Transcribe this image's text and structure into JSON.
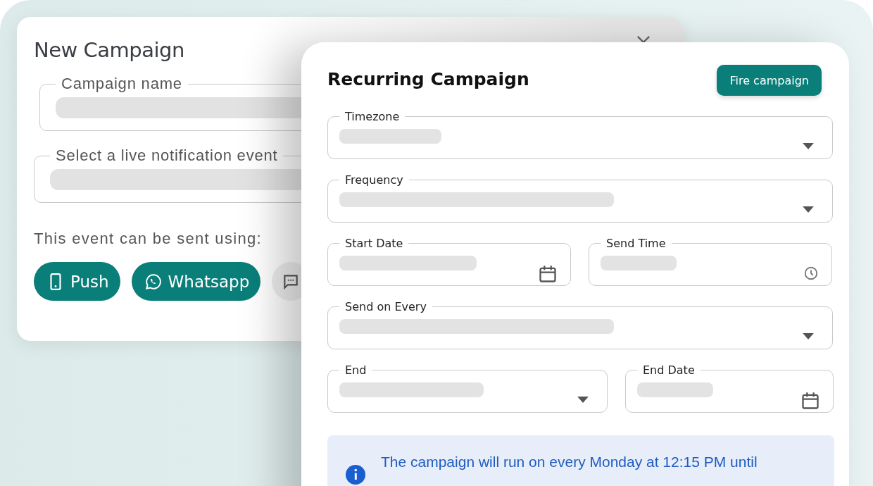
{
  "new_campaign": {
    "title": "New Campaign",
    "fields": [
      {
        "label": "Campaign name"
      },
      {
        "label": "Select a live notification event"
      }
    ],
    "channels_label": "This event can be sent using:",
    "channels": [
      {
        "label": "Push",
        "kind": "phone"
      },
      {
        "label": "Whatsapp",
        "kind": "whatsapp"
      },
      {
        "kind": "chat"
      }
    ]
  },
  "recurring_campaign": {
    "title": "Recurring Campaign",
    "action": "Fire campaign",
    "rows": [
      [
        {
          "label": "Timezone",
          "kind": "select"
        }
      ],
      [
        {
          "label": "Frequency",
          "kind": "select"
        }
      ],
      [
        {
          "label": "Start Date",
          "kind": "date"
        },
        {
          "label": "Send Time",
          "kind": "time"
        }
      ],
      [
        {
          "label": "Send on Every",
          "kind": "select"
        }
      ],
      [
        {
          "label": "End",
          "kind": "select"
        },
        {
          "label": "End Date",
          "kind": "date"
        }
      ]
    ],
    "info": "The campaign will run on every Monday at 12:15 PM until"
  }
}
